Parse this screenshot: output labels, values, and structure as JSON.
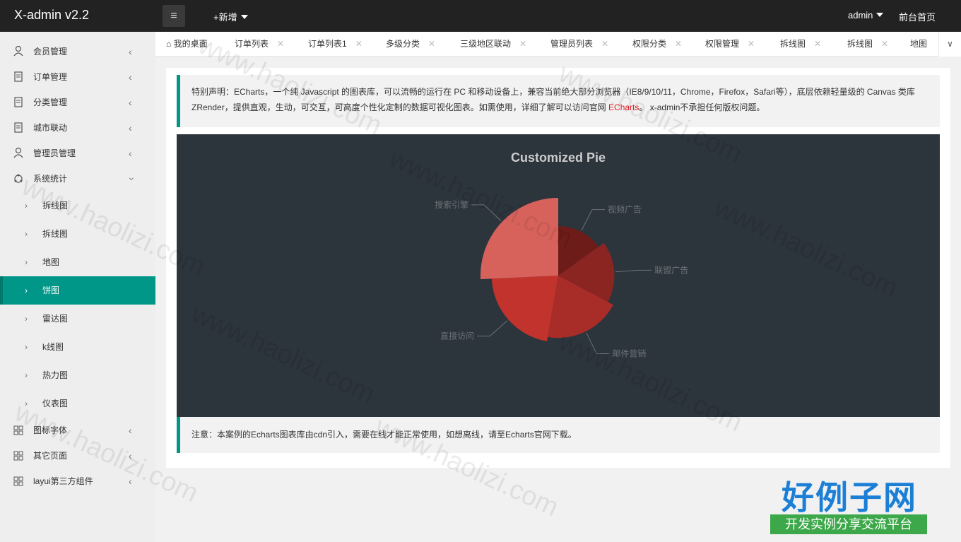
{
  "header": {
    "logo": "X-admin v2.2",
    "menu_icon": "≡",
    "add_new": "+新增",
    "user": "admin",
    "front_page": "前台首页"
  },
  "sidebar": {
    "items": [
      {
        "label": "会员管理",
        "icon": "user-icon"
      },
      {
        "label": "订单管理",
        "icon": "order-icon"
      },
      {
        "label": "分类管理",
        "icon": "order-icon"
      },
      {
        "label": "城市联动",
        "icon": "order-icon"
      },
      {
        "label": "管理员管理",
        "icon": "user-icon"
      },
      {
        "label": "系统统计",
        "icon": "chart-icon"
      }
    ],
    "sub_items": [
      {
        "label": "拆线图"
      },
      {
        "label": "拆线图"
      },
      {
        "label": "地图"
      },
      {
        "label": "饼图",
        "active": true
      },
      {
        "label": "雷达图"
      },
      {
        "label": "k线图"
      },
      {
        "label": "热力图"
      },
      {
        "label": "仪表图"
      }
    ],
    "bottom_items": [
      {
        "label": "图标字体",
        "icon": "grid-icon"
      },
      {
        "label": "其它页面",
        "icon": "grid-icon"
      },
      {
        "label": "layui第三方组件",
        "icon": "grid-icon"
      }
    ]
  },
  "tabs": [
    {
      "label": "我的桌面",
      "home": true
    },
    {
      "label": "订单列表"
    },
    {
      "label": "订单列表1"
    },
    {
      "label": "多级分类"
    },
    {
      "label": "三级地区联动"
    },
    {
      "label": "管理员列表"
    },
    {
      "label": "权限分类"
    },
    {
      "label": "权限管理"
    },
    {
      "label": "拆线图"
    },
    {
      "label": "拆线图"
    },
    {
      "label": "地图"
    }
  ],
  "notice1": {
    "text_before": "特别声明：ECharts，一个纯 Javascript 的图表库，可以流畅的运行在 PC 和移动设备上，兼容当前绝大部分浏览器（IE8/9/10/11，Chrome，Firefox，Safari等），底层依赖轻量级的 Canvas 类库 ZRender，提供直观，生动，可交互，可高度个性化定制的数据可视化图表。如需使用，详细了解可以访问官网 ",
    "link": "ECharts",
    "text_after": "。 x-admin不承担任何版权问题。"
  },
  "notice2": "注意：本案例的Echarts图表库由cdn引入，需要在线才能正常使用，如想离线，请至Echarts官网下载。",
  "watermark": {
    "title": "好例子网",
    "subtitle": "开发实例分享交流平台",
    "text": "www.haolizi.com"
  },
  "chart_data": {
    "type": "pie",
    "title": "Customized Pie",
    "style": "rose",
    "slices": [
      {
        "name": "视频广告",
        "value": 235,
        "color": "#6d1c19"
      },
      {
        "name": "联盟广告",
        "value": 274,
        "color": "#8a2521"
      },
      {
        "name": "邮件营销",
        "value": 310,
        "color": "#a82c27"
      },
      {
        "name": "直接访问",
        "value": 335,
        "color": "#c2332d"
      },
      {
        "name": "搜索引擎",
        "value": 400,
        "color": "#d7625c"
      }
    ]
  }
}
